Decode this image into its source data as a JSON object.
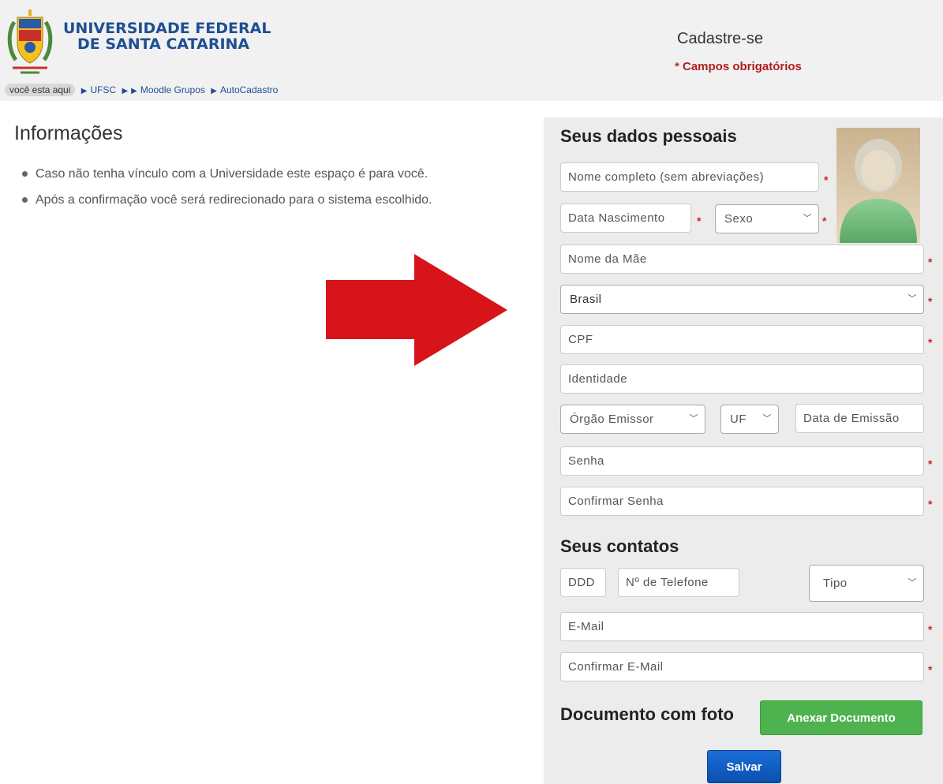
{
  "header": {
    "uni_line1": "UNIVERSIDADE FEDERAL",
    "uni_line2": "DE SANTA CATARINA",
    "page_title": "Cadastre-se",
    "required_star": "*",
    "required_note": " Campos obrigatórios"
  },
  "breadcrumb": {
    "here_label": "você esta aqui",
    "items": [
      "UFSC",
      "Moodle Grupos",
      "AutoCadastro"
    ]
  },
  "info": {
    "title": "Informações",
    "items": [
      "Caso não tenha vínculo com a Universidade este espaço é para você.",
      "Após a confirmação você será redirecionado para o sistema escolhido."
    ]
  },
  "form": {
    "personal_title": "Seus dados pessoais",
    "nome_placeholder": "Nome completo (sem abreviações)",
    "nascimento_placeholder": "Data Nascimento",
    "sexo_label": "Sexo",
    "mae_placeholder": "Nome da Mãe",
    "pais_value": "Brasil",
    "cpf_placeholder": "CPF",
    "identidade_placeholder": "Identidade",
    "orgao_label": "Órgão Emissor",
    "uf_label": "UF",
    "emissao_placeholder": "Data de Emissão",
    "senha_placeholder": "Senha",
    "confirmar_senha_placeholder": "Confirmar Senha",
    "contacts_title": "Seus contatos",
    "ddd_placeholder": "DDD",
    "telefone_placeholder": "Nº de Telefone",
    "tipo_label": "Tipo",
    "email_placeholder": "E-Mail",
    "confirmar_email_placeholder": "Confirmar E-Mail",
    "document_label": "Documento com foto",
    "anexar_label": "Anexar Documento",
    "salvar_label": "Salvar",
    "required_mark": "*"
  },
  "colors": {
    "brand_blue": "#1f4e93",
    "required_red": "#d02626",
    "arrow_red": "#d7141a",
    "anexar_green": "#4eb34f",
    "salvar_blue": "#0b5fc9",
    "panel_gray": "#ececec"
  },
  "icons": {
    "logo": "ufsc-crest-icon",
    "avatar": "user-avatar-icon",
    "arrow": "big-arrow-right-icon",
    "chevron": "chevron-down-icon",
    "breadcrumb_sep": "triangle-right-icon"
  }
}
